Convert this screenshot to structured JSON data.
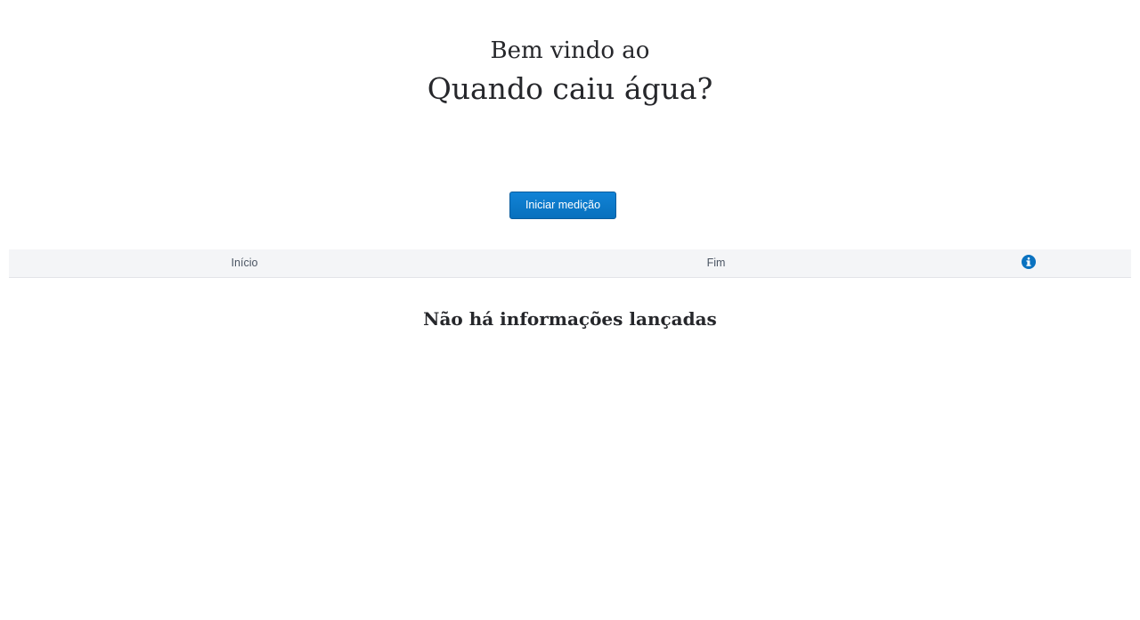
{
  "header": {
    "welcome": "Bem vindo ao",
    "app_title": "Quando caiu água?"
  },
  "actions": {
    "start_label": "Iniciar medição"
  },
  "table": {
    "columns": [
      "Início",
      "Fim"
    ],
    "info_icon": "info-circle-icon",
    "empty_message": "Não há informações lançadas"
  },
  "colors": {
    "accent": "#0a72c0",
    "text": "#26272b",
    "table_header_bg": "#f4f5f7"
  }
}
